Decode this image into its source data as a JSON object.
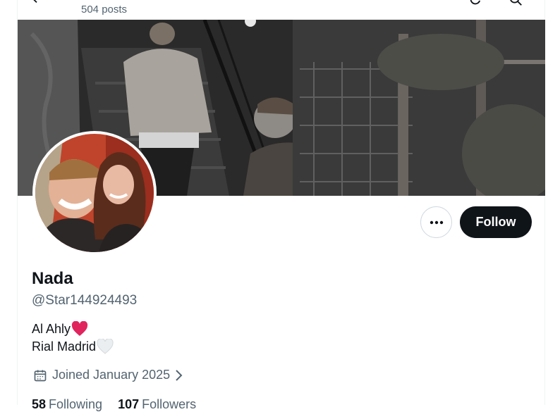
{
  "header": {
    "post_count": "504 posts"
  },
  "profile": {
    "display_name": "Nada",
    "handle": "@Star144924493",
    "bio": [
      {
        "text": "Al Ahly",
        "emoji": "red-heart"
      },
      {
        "text": "Rial Madrid",
        "emoji": "white-heart"
      }
    ],
    "joined": "Joined January 2025",
    "follow_label": "Follow",
    "stats": {
      "following_count": "58",
      "following_label": "Following",
      "followers_count": "107",
      "followers_label": "Followers"
    }
  },
  "icons": {
    "back": "back-arrow-icon",
    "refresh": "refresh-icon",
    "search": "search-icon",
    "more": "more-dots-icon",
    "calendar": "calendar-icon",
    "chevron": "chevron-right-icon"
  },
  "colors": {
    "follow_button": "#0f1419",
    "secondary_text": "#536471",
    "heart_red": "#e0245e",
    "heart_white": "#ebeef0"
  }
}
